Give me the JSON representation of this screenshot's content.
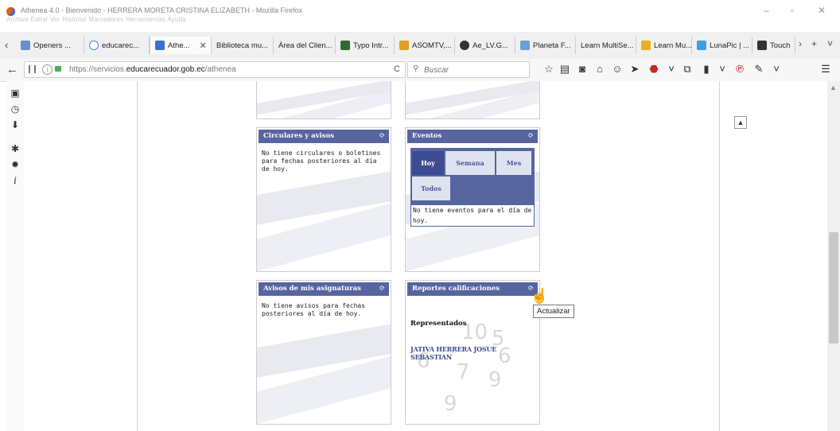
{
  "window": {
    "title": "Athenea 4.0 - Bienvenido - HERRERA MORETA CRISTINA ELIZABETH - Mozilla Firefox",
    "menu_items": [
      "Archivo",
      "Editar",
      "Ver",
      "Historial",
      "Marcadores",
      "Herramientas",
      "Ayuda"
    ],
    "controls": {
      "minimize": "–",
      "restore": "▫",
      "close": "✕"
    }
  },
  "tabs": [
    {
      "label": "Openers ...",
      "icon": "mail-icon",
      "color": "#6a8fd0"
    },
    {
      "label": "educarec...",
      "icon": "google-icon",
      "color": "#4285f4"
    },
    {
      "label": "Athe...",
      "icon": "athenea-icon",
      "color": "#3a6fcf",
      "active": true
    },
    {
      "label": "Biblioteca mu...",
      "icon": "none",
      "color": ""
    },
    {
      "label": "Área del Clien...",
      "icon": "none",
      "color": ""
    },
    {
      "label": "Typo Intr...",
      "icon": "typo-icon",
      "color": "#2f6b2f"
    },
    {
      "label": "ASOMTV,...",
      "icon": "asomtv-icon",
      "color": "#e0a020"
    },
    {
      "label": "Ae_LV.G...",
      "icon": "person-icon",
      "color": "#333"
    },
    {
      "label": "Planeta F...",
      "icon": "planet-icon",
      "color": "#6aa0d8"
    },
    {
      "label": "Learn MultiSe...",
      "icon": "none",
      "color": ""
    },
    {
      "label": "Learn Mu...",
      "icon": "pencil-icon",
      "color": "#e8b020"
    },
    {
      "label": "LunaPic | ...",
      "icon": "lunapic-icon",
      "color": "#3aa0e0"
    },
    {
      "label": "Touch",
      "icon": "touch-icon",
      "color": "#333"
    }
  ],
  "tabbar": {
    "close_glyph": "✕",
    "overflow": "›",
    "new_tab": "+",
    "list": "˅"
  },
  "nav": {
    "back_glyph": "←",
    "url_host_prefix": "https://servicios.",
    "url_domain": "educarecuador.gob.ec",
    "url_path": "/athenea",
    "reload_glyph": "C",
    "search_placeholder": "Buscar"
  },
  "widgets": {
    "circulares": {
      "title": "Circulares y avisos",
      "message": "No tiene circulares o boletines para fechas posteriores al día de hoy."
    },
    "eventos": {
      "title": "Eventos",
      "tabs": [
        "Hoy",
        "Semana",
        "Mes",
        "Todos"
      ],
      "message": "No tiene eventos para el día de hoy."
    },
    "avisos": {
      "title": "Avisos de mis asignaturas",
      "message": "No tiene avisos para fechas posteriores al día de hoy."
    },
    "reportes": {
      "title": "Reportes calificaciones",
      "subtitle": "Representados",
      "student": "JATIVA HERRERA JOSUE SEBASTIAN"
    }
  },
  "tooltip": "Actualizar",
  "colors": {
    "widget_header": "#5665a0",
    "selected_tab": "#3d4c92"
  }
}
